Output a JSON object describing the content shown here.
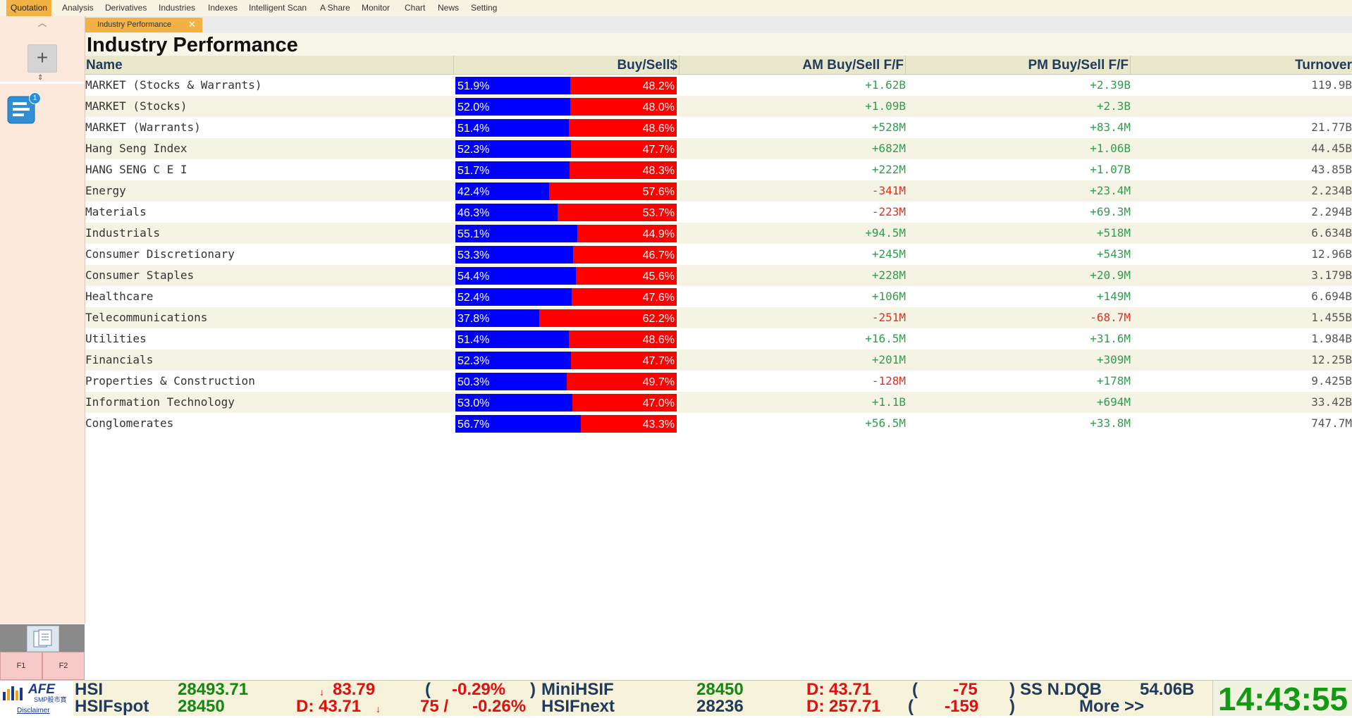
{
  "menu": [
    "Quotation",
    "Analysis",
    "Derivatives",
    "Industries",
    "Indexes",
    "Intelligent Scan",
    "A Share",
    "Monitor",
    "Chart",
    "News",
    "Setting"
  ],
  "sidebar": {
    "up_glyph": "︿",
    "add_glyph": "+",
    "split_glyph": "⇕",
    "badge": "1",
    "fkeys": [
      "F1",
      "F2"
    ]
  },
  "tab": {
    "label": "Industry Performance",
    "close": "✕"
  },
  "page_title": "Industry Performance",
  "columns": {
    "name": "Name",
    "buysell": "Buy/Sell$",
    "am": "AM Buy/Sell F/F",
    "pm": "PM Buy/Sell F/F",
    "turnover": "Turnover"
  },
  "rows": [
    {
      "name": "MARKET (Stocks & Warrants)",
      "buy": "51.9%",
      "sell": "48.2%",
      "buy_frac": 0.519,
      "am": "+1.62B",
      "pm": "+2.39B",
      "turnover": "119.9B"
    },
    {
      "name": "MARKET (Stocks)",
      "buy": "52.0%",
      "sell": "48.0%",
      "buy_frac": 0.52,
      "am": "+1.09B",
      "pm": "+2.3B",
      "turnover": ""
    },
    {
      "name": "MARKET (Warrants)",
      "buy": "51.4%",
      "sell": "48.6%",
      "buy_frac": 0.514,
      "am": "+528M",
      "pm": "+83.4M",
      "turnover": "21.77B"
    },
    {
      "name": "Hang Seng Index",
      "buy": "52.3%",
      "sell": "47.7%",
      "buy_frac": 0.523,
      "am": "+682M",
      "pm": "+1.06B",
      "turnover": "44.45B"
    },
    {
      "name": "HANG SENG C E I",
      "buy": "51.7%",
      "sell": "48.3%",
      "buy_frac": 0.517,
      "am": "+222M",
      "pm": "+1.07B",
      "turnover": "43.85B"
    },
    {
      "name": "Energy",
      "buy": "42.4%",
      "sell": "57.6%",
      "buy_frac": 0.424,
      "am": "-341M",
      "pm": "+23.4M",
      "turnover": "2.234B"
    },
    {
      "name": "Materials",
      "buy": "46.3%",
      "sell": "53.7%",
      "buy_frac": 0.463,
      "am": "-223M",
      "pm": "+69.3M",
      "turnover": "2.294B"
    },
    {
      "name": "Industrials",
      "buy": "55.1%",
      "sell": "44.9%",
      "buy_frac": 0.551,
      "am": "+94.5M",
      "pm": "+518M",
      "turnover": "6.634B"
    },
    {
      "name": "Consumer Discretionary",
      "buy": "53.3%",
      "sell": "46.7%",
      "buy_frac": 0.533,
      "am": "+245M",
      "pm": "+543M",
      "turnover": "12.96B"
    },
    {
      "name": "Consumer Staples",
      "buy": "54.4%",
      "sell": "45.6%",
      "buy_frac": 0.544,
      "am": "+228M",
      "pm": "+20.9M",
      "turnover": "3.179B"
    },
    {
      "name": "Healthcare",
      "buy": "52.4%",
      "sell": "47.6%",
      "buy_frac": 0.524,
      "am": "+106M",
      "pm": "+149M",
      "turnover": "6.694B"
    },
    {
      "name": "Telecommunications",
      "buy": "37.8%",
      "sell": "62.2%",
      "buy_frac": 0.378,
      "am": "-251M",
      "pm": "-68.7M",
      "turnover": "1.455B"
    },
    {
      "name": "Utilities",
      "buy": "51.4%",
      "sell": "48.6%",
      "buy_frac": 0.514,
      "am": "+16.5M",
      "pm": "+31.6M",
      "turnover": "1.984B"
    },
    {
      "name": "Financials",
      "buy": "52.3%",
      "sell": "47.7%",
      "buy_frac": 0.523,
      "am": "+201M",
      "pm": "+309M",
      "turnover": "12.25B"
    },
    {
      "name": "Properties & Construction",
      "buy": "50.3%",
      "sell": "49.7%",
      "buy_frac": 0.503,
      "am": "-128M",
      "pm": "+178M",
      "turnover": "9.425B"
    },
    {
      "name": "Information Technology",
      "buy": "53.0%",
      "sell": "47.0%",
      "buy_frac": 0.53,
      "am": "+1.1B",
      "pm": "+694M",
      "turnover": "33.42B"
    },
    {
      "name": "Conglomerates",
      "buy": "56.7%",
      "sell": "43.3%",
      "buy_frac": 0.567,
      "am": "+56.5M",
      "pm": "+33.8M",
      "turnover": "747.7M"
    }
  ],
  "colors": {
    "buy": "#0000ff",
    "sell": "#ff0000",
    "positive": "#2f9e4f",
    "negative": "#e03020",
    "accent_tab": "#f3b244"
  },
  "logo": {
    "text": "AFE",
    "subtext": "SMP股市寶",
    "disclaimer": "Disclaimer"
  },
  "ticker": {
    "r1": {
      "name1": "HSI",
      "val1": "28493.71",
      "arrow": "↓",
      "chg": "83.79",
      "paren_open": "(",
      "pct": "-0.29%",
      "paren_close": ")",
      "name2": "MiniHSIF",
      "val2": "28450",
      "diff": "D: 43.71",
      "p2o": "(",
      "chg2": "-75",
      "p2c": ")",
      "name3": "SS N.DQB",
      "val3": "54.06B"
    },
    "r2": {
      "name1": "HSIFspot",
      "val1": "28450",
      "diff": "D: 43.71",
      "arrow": "↓",
      "chg": "75 /",
      "pct": "-0.26%",
      "name2": "HSIFnext",
      "val2": "28236",
      "diff2": "D: 257.71",
      "p2o": "(",
      "chg2": "-159",
      "p2c": ")",
      "more": "More >>"
    },
    "clock": "14:43:55"
  }
}
